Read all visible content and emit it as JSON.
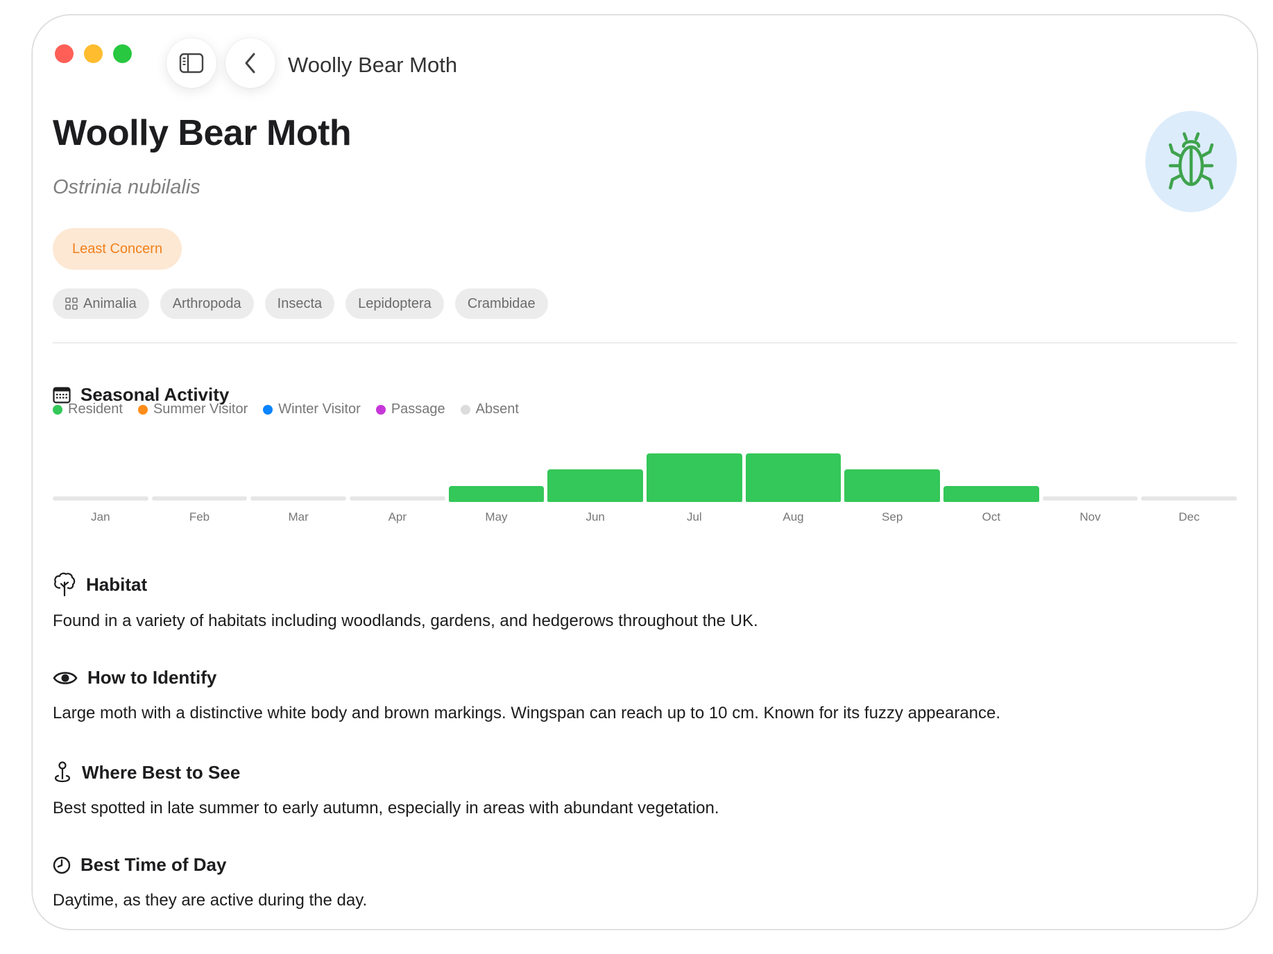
{
  "window": {
    "title": "Woolly Bear Moth"
  },
  "header": {
    "common_name": "Woolly Bear Moth",
    "scientific_name": "Ostrinia nubilalis",
    "avatar_icon": "bug-icon"
  },
  "status": {
    "label": "Least Concern",
    "color": "#f0801a"
  },
  "taxonomy": [
    "Animalia",
    "Arthropoda",
    "Insecta",
    "Lepidoptera",
    "Crambidae"
  ],
  "seasonal": {
    "title": "Seasonal Activity",
    "legend": [
      {
        "label": "Resident",
        "color": "#34c759"
      },
      {
        "label": "Summer Visitor",
        "color": "#ff8c1a"
      },
      {
        "label": "Winter Visitor",
        "color": "#0a84ff"
      },
      {
        "label": "Passage",
        "color": "#c637d9"
      },
      {
        "label": "Absent",
        "color": "#dcdcdc"
      }
    ]
  },
  "chart_data": {
    "type": "bar",
    "categories": [
      "Jan",
      "Feb",
      "Mar",
      "Apr",
      "May",
      "Jun",
      "Jul",
      "Aug",
      "Sep",
      "Oct",
      "Nov",
      "Dec"
    ],
    "values": [
      0,
      0,
      0,
      0,
      1,
      2,
      3,
      3,
      2,
      1,
      0,
      0
    ],
    "status": [
      "Absent",
      "Absent",
      "Absent",
      "Absent",
      "Resident",
      "Resident",
      "Resident",
      "Resident",
      "Resident",
      "Resident",
      "Absent",
      "Absent"
    ],
    "ylim": [
      0,
      3
    ]
  },
  "habitat": {
    "title": "Habitat",
    "text": "Found in a variety of habitats including woodlands, gardens, and hedgerows throughout the UK."
  },
  "identify": {
    "title": "How to Identify",
    "text": "Large moth with a distinctive white body and brown markings. Wingspan can reach up to 10 cm. Known for its fuzzy appearance."
  },
  "where": {
    "title": "Where Best to See",
    "text": "Best spotted in late summer to early autumn, especially in areas with abundant vegetation."
  },
  "time": {
    "title": "Best Time of Day",
    "text": "Daytime, as they are active during the day."
  }
}
